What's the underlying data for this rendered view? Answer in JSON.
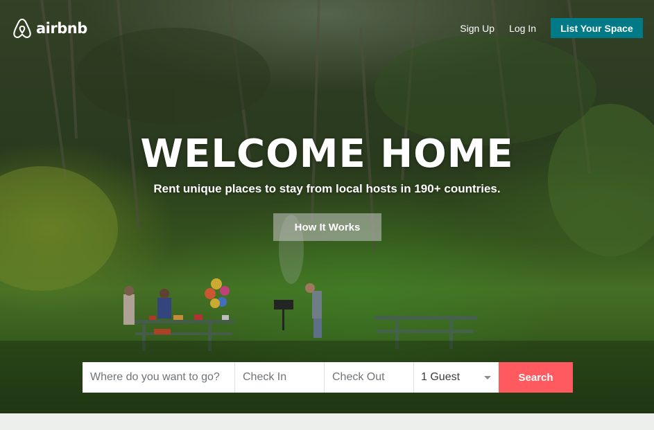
{
  "brand": {
    "name": "airbnb",
    "logo_icon": "airbnb-belo-icon"
  },
  "header": {
    "signup_label": "Sign Up",
    "login_label": "Log In",
    "list_space_label": "List Your Space"
  },
  "hero": {
    "title": "WELCOME HOME",
    "subtitle": "Rent unique places to stay from local hosts in 190+ countries.",
    "how_it_works_label": "How It Works"
  },
  "search": {
    "where_placeholder": "Where do you want to go?",
    "checkin_placeholder": "Check In",
    "checkout_placeholder": "Check Out",
    "guests_value": "1 Guest",
    "guests_icon": "chevron-down-icon",
    "submit_label": "Search"
  },
  "colors": {
    "accent_teal": "#007a87",
    "search_button": "#ff5a5f",
    "text_white": "#ffffff"
  }
}
